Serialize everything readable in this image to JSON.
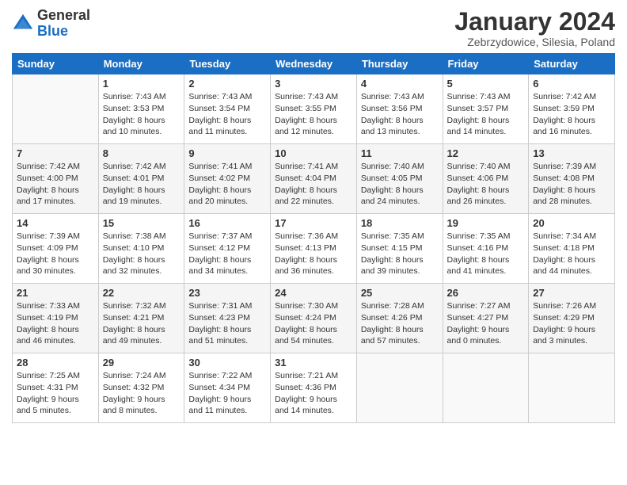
{
  "logo": {
    "general": "General",
    "blue": "Blue"
  },
  "header": {
    "title": "January 2024",
    "location": "Zebrzydowice, Silesia, Poland"
  },
  "days_of_week": [
    "Sunday",
    "Monday",
    "Tuesday",
    "Wednesday",
    "Thursday",
    "Friday",
    "Saturday"
  ],
  "weeks": [
    [
      {
        "day": "",
        "info": ""
      },
      {
        "day": "1",
        "info": "Sunrise: 7:43 AM\nSunset: 3:53 PM\nDaylight: 8 hours\nand 10 minutes."
      },
      {
        "day": "2",
        "info": "Sunrise: 7:43 AM\nSunset: 3:54 PM\nDaylight: 8 hours\nand 11 minutes."
      },
      {
        "day": "3",
        "info": "Sunrise: 7:43 AM\nSunset: 3:55 PM\nDaylight: 8 hours\nand 12 minutes."
      },
      {
        "day": "4",
        "info": "Sunrise: 7:43 AM\nSunset: 3:56 PM\nDaylight: 8 hours\nand 13 minutes."
      },
      {
        "day": "5",
        "info": "Sunrise: 7:43 AM\nSunset: 3:57 PM\nDaylight: 8 hours\nand 14 minutes."
      },
      {
        "day": "6",
        "info": "Sunrise: 7:42 AM\nSunset: 3:59 PM\nDaylight: 8 hours\nand 16 minutes."
      }
    ],
    [
      {
        "day": "7",
        "info": "Sunrise: 7:42 AM\nSunset: 4:00 PM\nDaylight: 8 hours\nand 17 minutes."
      },
      {
        "day": "8",
        "info": "Sunrise: 7:42 AM\nSunset: 4:01 PM\nDaylight: 8 hours\nand 19 minutes."
      },
      {
        "day": "9",
        "info": "Sunrise: 7:41 AM\nSunset: 4:02 PM\nDaylight: 8 hours\nand 20 minutes."
      },
      {
        "day": "10",
        "info": "Sunrise: 7:41 AM\nSunset: 4:04 PM\nDaylight: 8 hours\nand 22 minutes."
      },
      {
        "day": "11",
        "info": "Sunrise: 7:40 AM\nSunset: 4:05 PM\nDaylight: 8 hours\nand 24 minutes."
      },
      {
        "day": "12",
        "info": "Sunrise: 7:40 AM\nSunset: 4:06 PM\nDaylight: 8 hours\nand 26 minutes."
      },
      {
        "day": "13",
        "info": "Sunrise: 7:39 AM\nSunset: 4:08 PM\nDaylight: 8 hours\nand 28 minutes."
      }
    ],
    [
      {
        "day": "14",
        "info": "Sunrise: 7:39 AM\nSunset: 4:09 PM\nDaylight: 8 hours\nand 30 minutes."
      },
      {
        "day": "15",
        "info": "Sunrise: 7:38 AM\nSunset: 4:10 PM\nDaylight: 8 hours\nand 32 minutes."
      },
      {
        "day": "16",
        "info": "Sunrise: 7:37 AM\nSunset: 4:12 PM\nDaylight: 8 hours\nand 34 minutes."
      },
      {
        "day": "17",
        "info": "Sunrise: 7:36 AM\nSunset: 4:13 PM\nDaylight: 8 hours\nand 36 minutes."
      },
      {
        "day": "18",
        "info": "Sunrise: 7:35 AM\nSunset: 4:15 PM\nDaylight: 8 hours\nand 39 minutes."
      },
      {
        "day": "19",
        "info": "Sunrise: 7:35 AM\nSunset: 4:16 PM\nDaylight: 8 hours\nand 41 minutes."
      },
      {
        "day": "20",
        "info": "Sunrise: 7:34 AM\nSunset: 4:18 PM\nDaylight: 8 hours\nand 44 minutes."
      }
    ],
    [
      {
        "day": "21",
        "info": "Sunrise: 7:33 AM\nSunset: 4:19 PM\nDaylight: 8 hours\nand 46 minutes."
      },
      {
        "day": "22",
        "info": "Sunrise: 7:32 AM\nSunset: 4:21 PM\nDaylight: 8 hours\nand 49 minutes."
      },
      {
        "day": "23",
        "info": "Sunrise: 7:31 AM\nSunset: 4:23 PM\nDaylight: 8 hours\nand 51 minutes."
      },
      {
        "day": "24",
        "info": "Sunrise: 7:30 AM\nSunset: 4:24 PM\nDaylight: 8 hours\nand 54 minutes."
      },
      {
        "day": "25",
        "info": "Sunrise: 7:28 AM\nSunset: 4:26 PM\nDaylight: 8 hours\nand 57 minutes."
      },
      {
        "day": "26",
        "info": "Sunrise: 7:27 AM\nSunset: 4:27 PM\nDaylight: 9 hours\nand 0 minutes."
      },
      {
        "day": "27",
        "info": "Sunrise: 7:26 AM\nSunset: 4:29 PM\nDaylight: 9 hours\nand 3 minutes."
      }
    ],
    [
      {
        "day": "28",
        "info": "Sunrise: 7:25 AM\nSunset: 4:31 PM\nDaylight: 9 hours\nand 5 minutes."
      },
      {
        "day": "29",
        "info": "Sunrise: 7:24 AM\nSunset: 4:32 PM\nDaylight: 9 hours\nand 8 minutes."
      },
      {
        "day": "30",
        "info": "Sunrise: 7:22 AM\nSunset: 4:34 PM\nDaylight: 9 hours\nand 11 minutes."
      },
      {
        "day": "31",
        "info": "Sunrise: 7:21 AM\nSunset: 4:36 PM\nDaylight: 9 hours\nand 14 minutes."
      },
      {
        "day": "",
        "info": ""
      },
      {
        "day": "",
        "info": ""
      },
      {
        "day": "",
        "info": ""
      }
    ]
  ]
}
